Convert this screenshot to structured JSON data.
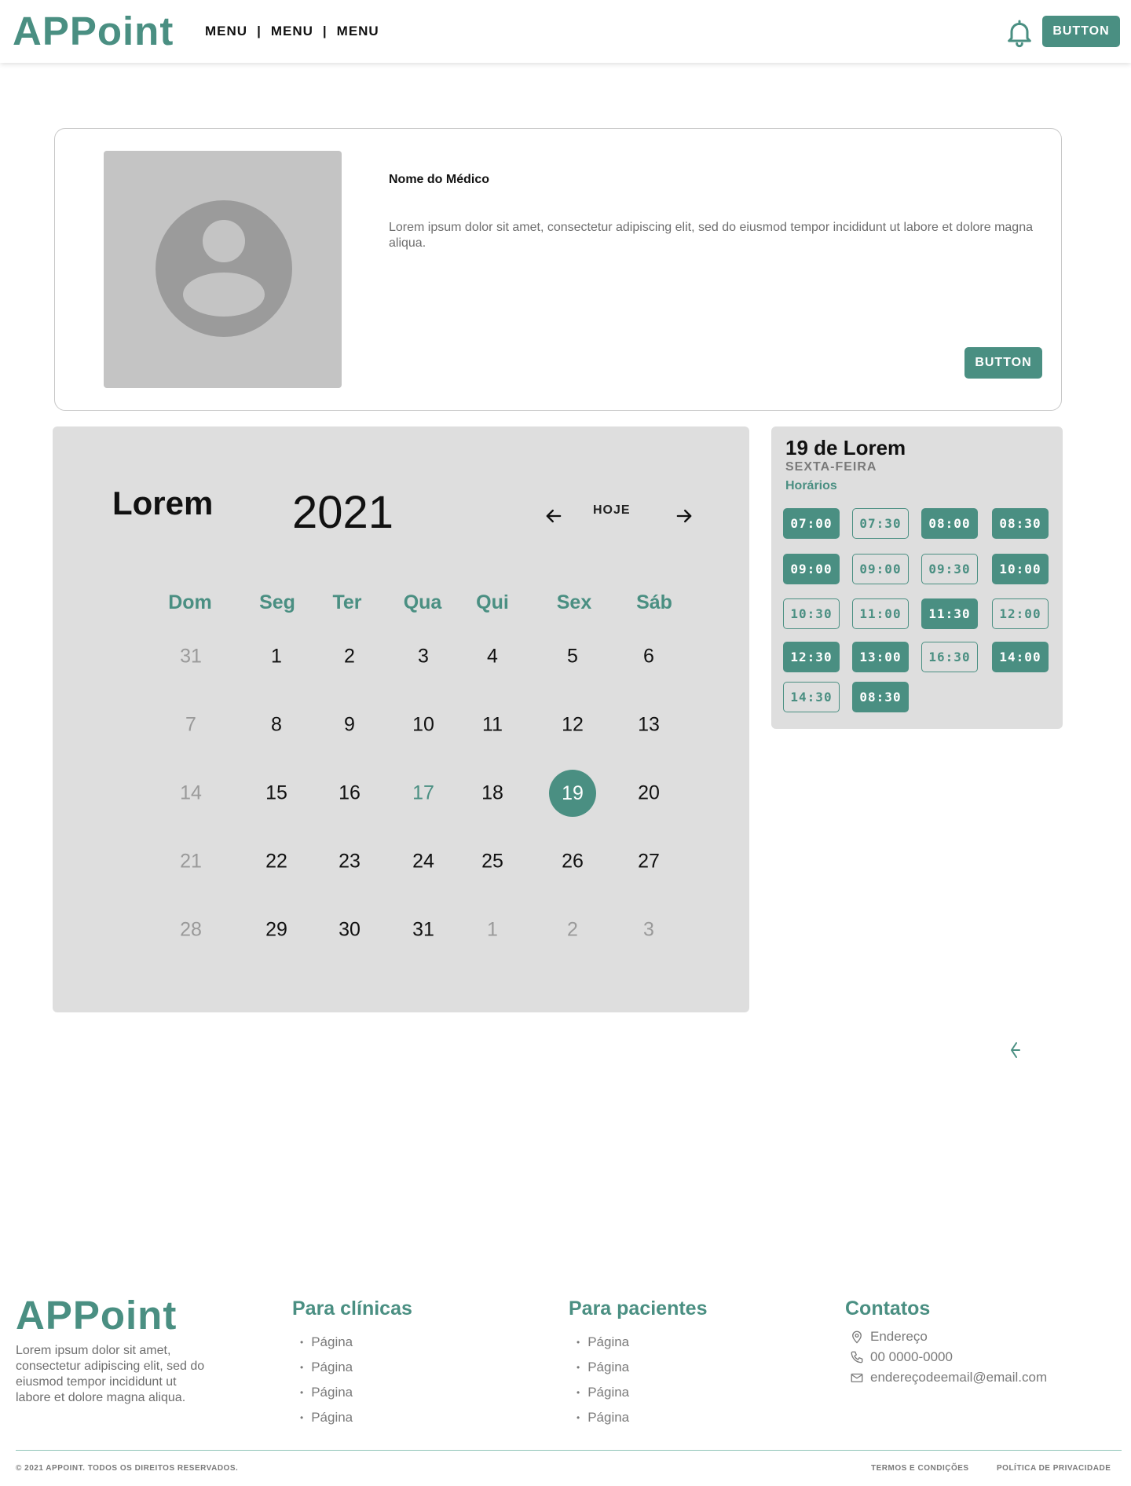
{
  "header": {
    "logo": "APPoint",
    "menu": [
      "MENU",
      "MENU",
      "MENU"
    ],
    "separator": "|",
    "button_label": "BUTTON"
  },
  "doctor": {
    "name": "Nome do Médico",
    "description": "Lorem ipsum dolor sit amet, consectetur adipiscing elit, sed do eiusmod tempor incididunt ut labore et dolore magna aliqua.",
    "button_label": "BUTTON"
  },
  "calendar": {
    "month": "Lorem",
    "year": "2021",
    "today_label": "HOJE",
    "weekdays": [
      "Dom",
      "Seg",
      "Ter",
      "Qua",
      "Qui",
      "Sex",
      "Sáb"
    ],
    "weeks": [
      [
        "31",
        "1",
        "2",
        "3",
        "4",
        "5",
        "6"
      ],
      [
        "7",
        "8",
        "9",
        "10",
        "11",
        "12",
        "13"
      ],
      [
        "14",
        "15",
        "16",
        "17",
        "18",
        "19",
        "20"
      ],
      [
        "21",
        "22",
        "23",
        "24",
        "25",
        "26",
        "27"
      ],
      [
        "28",
        "29",
        "30",
        "31",
        "1",
        "2",
        "3"
      ]
    ],
    "selected_day": "19",
    "highlight_day": "17"
  },
  "times": {
    "date": "19 de Lorem",
    "weekday": "SEXTA-FEIRA",
    "label": "Horários",
    "slots": [
      {
        "time": "07:00",
        "style": "filled"
      },
      {
        "time": "07:30",
        "style": "outline"
      },
      {
        "time": "08:00",
        "style": "filled"
      },
      {
        "time": "08:30",
        "style": "filled"
      },
      {
        "time": "09:00",
        "style": "filled"
      },
      {
        "time": "09:00",
        "style": "outline"
      },
      {
        "time": "09:30",
        "style": "outline"
      },
      {
        "time": "10:00",
        "style": "filled"
      },
      {
        "time": "10:30",
        "style": "outline"
      },
      {
        "time": "11:00",
        "style": "outline"
      },
      {
        "time": "11:30",
        "style": "filled"
      },
      {
        "time": "12:00",
        "style": "outline"
      },
      {
        "time": "12:30",
        "style": "filled"
      },
      {
        "time": "13:00",
        "style": "filled"
      },
      {
        "time": "16:30",
        "style": "outline"
      },
      {
        "time": "14:00",
        "style": "filled"
      },
      {
        "time": "14:30",
        "style": "outline"
      },
      {
        "time": "08:30",
        "style": "filled"
      }
    ]
  },
  "footer": {
    "logo": "APPoint",
    "about": "Lorem ipsum dolor sit amet, consectetur adipiscing elit, sed do eiusmod tempor incididunt ut labore et dolore magna aliqua.",
    "clinics": {
      "title": "Para clínicas",
      "items": [
        "Página",
        "Página",
        "Página",
        "Página"
      ]
    },
    "patients": {
      "title": "Para pacientes",
      "items": [
        "Página",
        "Página",
        "Página",
        "Página"
      ]
    },
    "contacts": {
      "title": "Contatos",
      "address": "Endereço",
      "phone": "00 0000-0000",
      "email": "endereçodeemail@email.com"
    },
    "copyright": "© 2021 APPOINT. TODOS OS DIREITOS RESERVADOS.",
    "terms": "TERMOS E CONDIÇÕES",
    "privacy": "POLÍTICA DE PRIVACIDADE"
  },
  "colors": {
    "accent": "#4a8f82",
    "panel": "#dedede",
    "photo": "#c4c4c4",
    "avatar": "#9b9b9b"
  },
  "icons": [
    "bell-icon",
    "arrow-left-icon",
    "arrow-right-icon",
    "user-avatar-icon",
    "back-arrow-icon",
    "map-pin-icon",
    "phone-icon",
    "mail-icon"
  ]
}
